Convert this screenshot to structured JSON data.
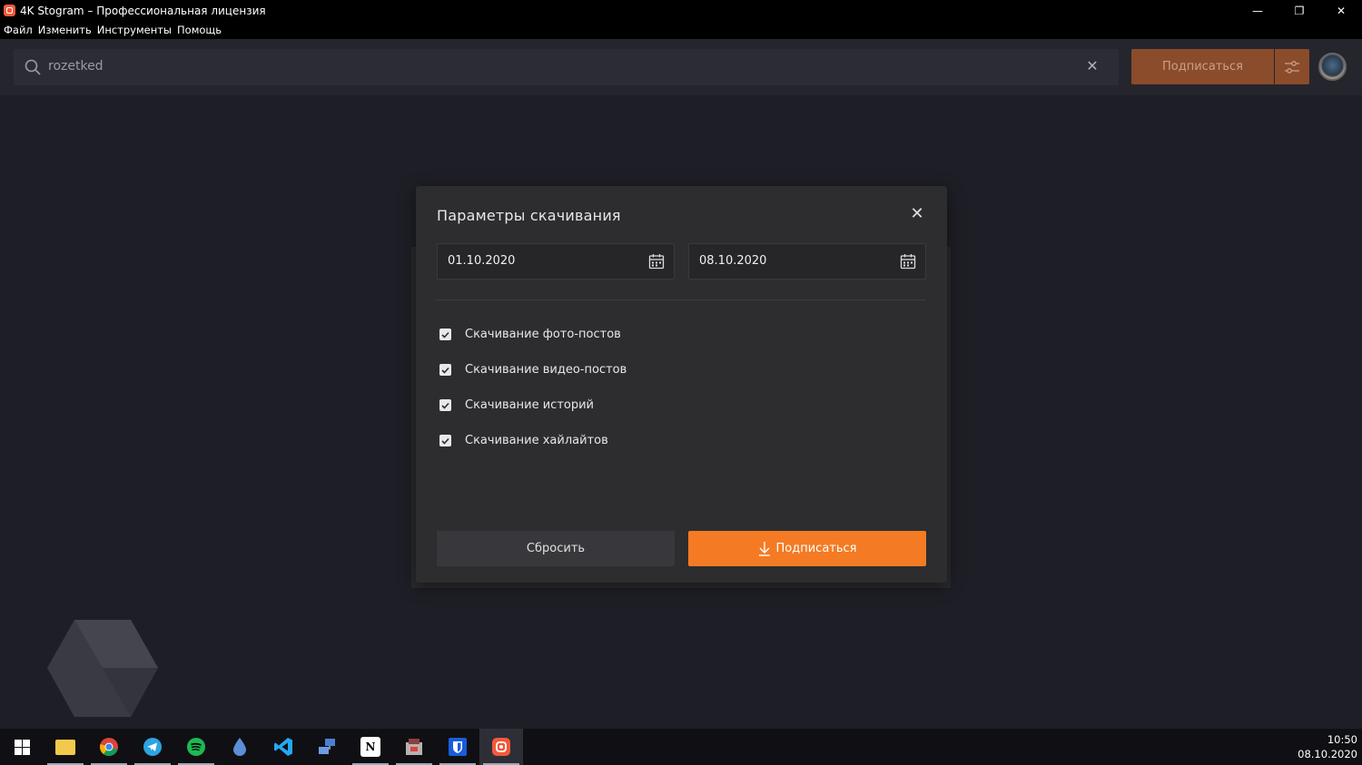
{
  "window": {
    "title": "4K Stogram – Профессиональная лицензия",
    "minimize": "—",
    "maximize": "❐",
    "close": "✕"
  },
  "menu": [
    "Файл",
    "Изменить",
    "Инструменты",
    "Помощь"
  ],
  "toolbar": {
    "search_value": "rozetked",
    "clear_icon": "✕",
    "subscribe_label": "Подписаться"
  },
  "dialog": {
    "title": "Параметры скачивания",
    "close_icon": "✕",
    "date_from": "01.10.2020",
    "date_to": "08.10.2020",
    "options": [
      {
        "label": "Скачивание фото-постов",
        "checked": true
      },
      {
        "label": "Скачивание видео-постов",
        "checked": true
      },
      {
        "label": "Скачивание историй",
        "checked": true
      },
      {
        "label": "Скачивание хайлайтов",
        "checked": true
      }
    ],
    "reset_label": "Сбросить",
    "subscribe_label": "Подписаться"
  },
  "colors": {
    "accent": "#f47b24",
    "accent_disabled": "#8a4c2b",
    "background": "#1e1e26",
    "dialog_bg": "#2d2d30"
  },
  "taskbar": {
    "apps": [
      "windows-start-icon",
      "file-explorer-icon",
      "chrome-icon",
      "telegram-icon",
      "spotify-icon",
      "drop-icon",
      "vscode-icon",
      "network-icon",
      "notion-icon",
      "game-icon",
      "bitwarden-icon",
      "stogram-icon"
    ],
    "time": "10:50",
    "date": "08.10.2020"
  }
}
